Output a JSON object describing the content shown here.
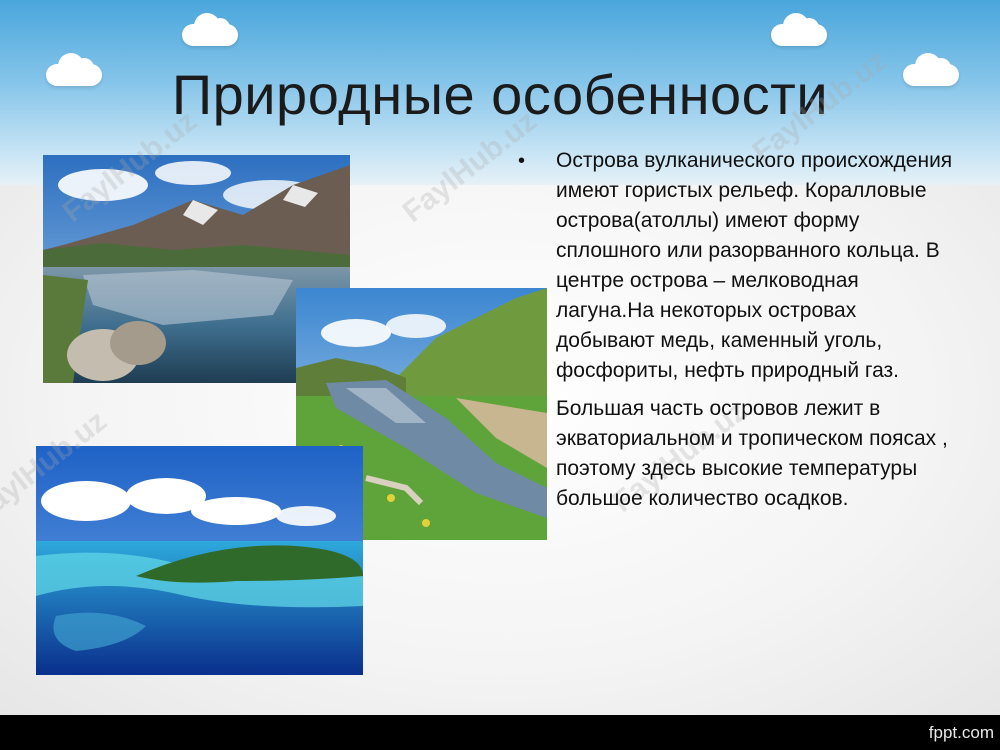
{
  "slide": {
    "title": "Природные особенности",
    "paragraph1": "Острова вулканического происхождения имеют гористых рельеф. Коралловые острова(атоллы) имеют форму сплошного или разорванного кольца. В центре острова – мелководная лагуна.На некоторых островах  добывают медь, каменный уголь, фосфориты, нефть природный газ.",
    "paragraph2": "Большая часть островов лежит в экваториальном и тропическом поясах , поэтому здесь высокие температуры большое количество осадков.",
    "bullet": "•"
  },
  "watermark": "FaylHub.uz",
  "footer": {
    "brand": "fppt.com"
  },
  "colors": {
    "sky_top": "#4aa6dc",
    "sky_bottom": "#e6f1f7",
    "footer_bar": "#000000",
    "title_text": "#1b1b1b"
  },
  "images": [
    {
      "name": "mountain-lake-photo"
    },
    {
      "name": "river-meadow-photo"
    },
    {
      "name": "tropical-island-photo"
    }
  ]
}
